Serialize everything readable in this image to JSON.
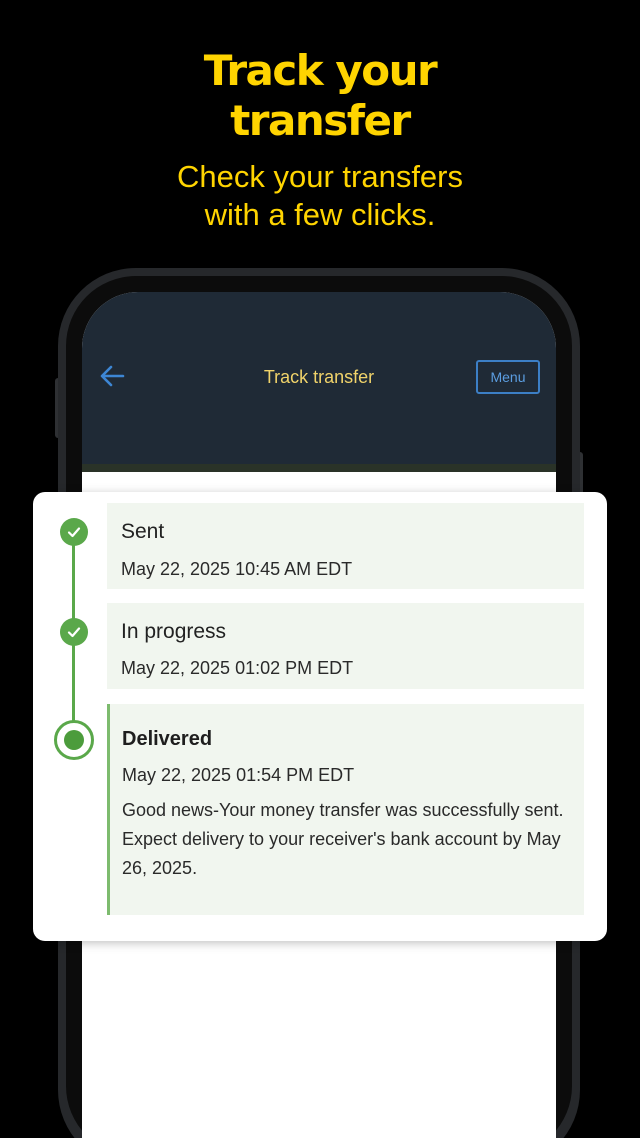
{
  "promo": {
    "headline_line1": "Track your",
    "headline_line2": "transfer",
    "subline_line1": "Check your transfers",
    "subline_line2": "with a few clicks."
  },
  "app_header": {
    "title": "Track transfer",
    "menu_label": "Menu",
    "back_icon": "arrow-left-icon"
  },
  "timeline": {
    "steps": [
      {
        "title": "Sent",
        "date": "May 22, 2025 10:45 AM EDT",
        "status": "complete"
      },
      {
        "title": "In progress",
        "date": "May 22, 2025 01:02 PM EDT",
        "status": "complete"
      },
      {
        "title": "Delivered",
        "date": "May 22, 2025 01:54 PM EDT",
        "status": "current",
        "note": "Good news-Your money transfer was successfully sent. Expect delivery to your receiver's bank account by May 26, 2025."
      }
    ]
  },
  "colors": {
    "promo_yellow": "#ffd400",
    "header_bg": "#1f2a36",
    "header_title": "#f0d36a",
    "menu_blue": "#3c7fc6",
    "success_green": "#5aa84a",
    "step_panel_bg": "#f1f6ef"
  }
}
